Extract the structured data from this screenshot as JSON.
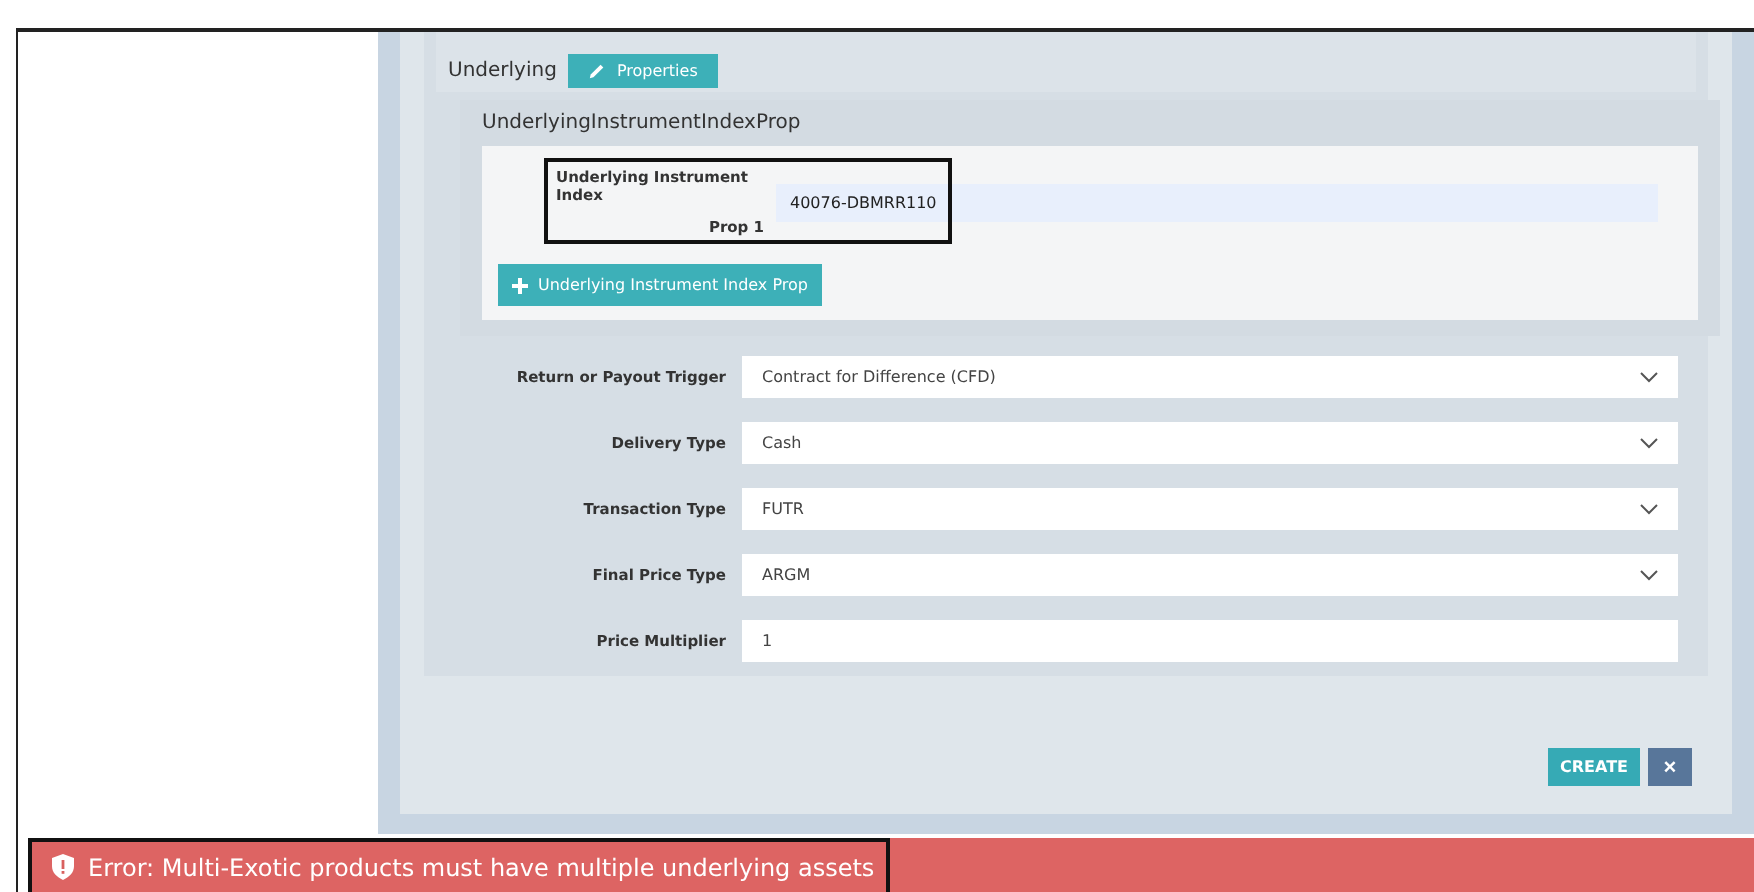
{
  "underlying": {
    "label": "Underlying",
    "button": "Properties"
  },
  "prop_group": {
    "title": "UnderlyingInstrumentIndexProp",
    "field": {
      "label_lines": [
        "Underlying Instrument Index",
        "Prop 1"
      ],
      "value": "40076-DBMRR110",
      "highlighted": true
    },
    "add_button": "Underlying Instrument Index Prop"
  },
  "fields": [
    {
      "kind": "select",
      "label": "Return or Payout Trigger",
      "value": "Contract for Difference (CFD)"
    },
    {
      "kind": "select",
      "label": "Delivery Type",
      "value": "Cash"
    },
    {
      "kind": "select",
      "label": "Transaction Type",
      "value": "FUTR"
    },
    {
      "kind": "select",
      "label": "Final Price Type",
      "value": "ARGM"
    },
    {
      "kind": "text",
      "label": "Price Multiplier",
      "value": "1"
    }
  ],
  "actions": {
    "create": "CREATE",
    "close": "×"
  },
  "error": {
    "message": "Error: Multi-Exotic products must have multiple underlying assets",
    "highlighted": true
  }
}
